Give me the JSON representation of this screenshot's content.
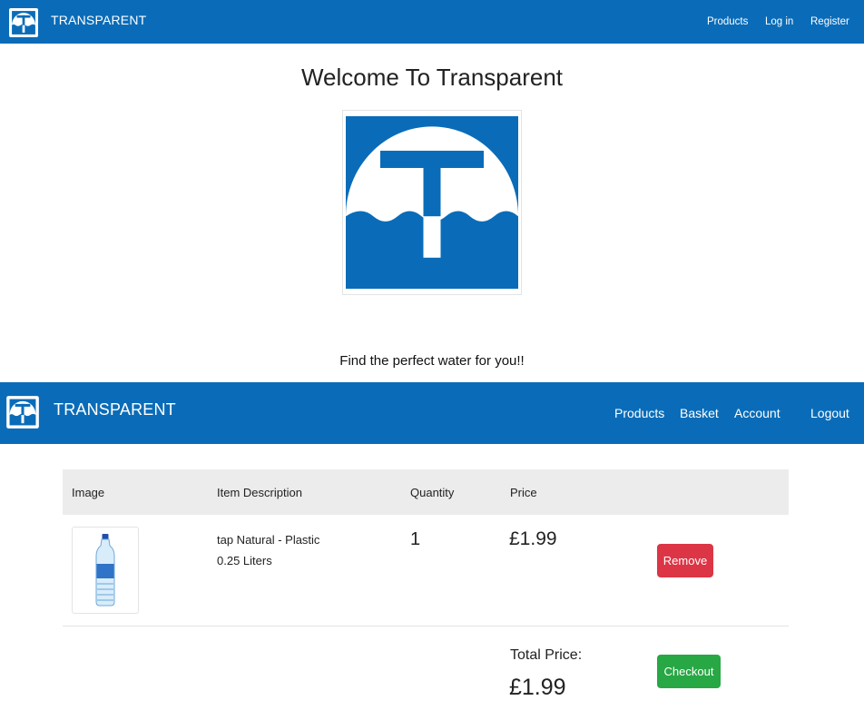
{
  "colors": {
    "navbar": "#0a6cb8",
    "remove_button": "#dc3545",
    "checkout_button": "#28a745",
    "table_header": "#ececec"
  },
  "home": {
    "brand": "TRANSPARENT",
    "nav": {
      "products": "Products",
      "login": "Log in",
      "register": "Register"
    },
    "welcome_heading": "Welcome To Transparent",
    "tagline": "Find the perfect water for you!!",
    "logo_icon": "umbrella-t-logo-icon"
  },
  "basket": {
    "brand": "TRANSPARENT",
    "nav": {
      "products": "Products",
      "basket": "Basket",
      "account": "Account",
      "logout": "Logout"
    },
    "table": {
      "headers": {
        "image": "Image",
        "description": "Item Description",
        "quantity": "Quantity",
        "price": "Price"
      },
      "rows": [
        {
          "image_icon": "water-bottle-icon",
          "description_line1": "tap Natural - Plastic",
          "description_line2": "0.25 Liters",
          "quantity": "1",
          "price": "£1.99",
          "remove_label": "Remove"
        }
      ]
    },
    "total_label": "Total Price:",
    "total_value": "£1.99",
    "checkout_label": "Checkout"
  }
}
